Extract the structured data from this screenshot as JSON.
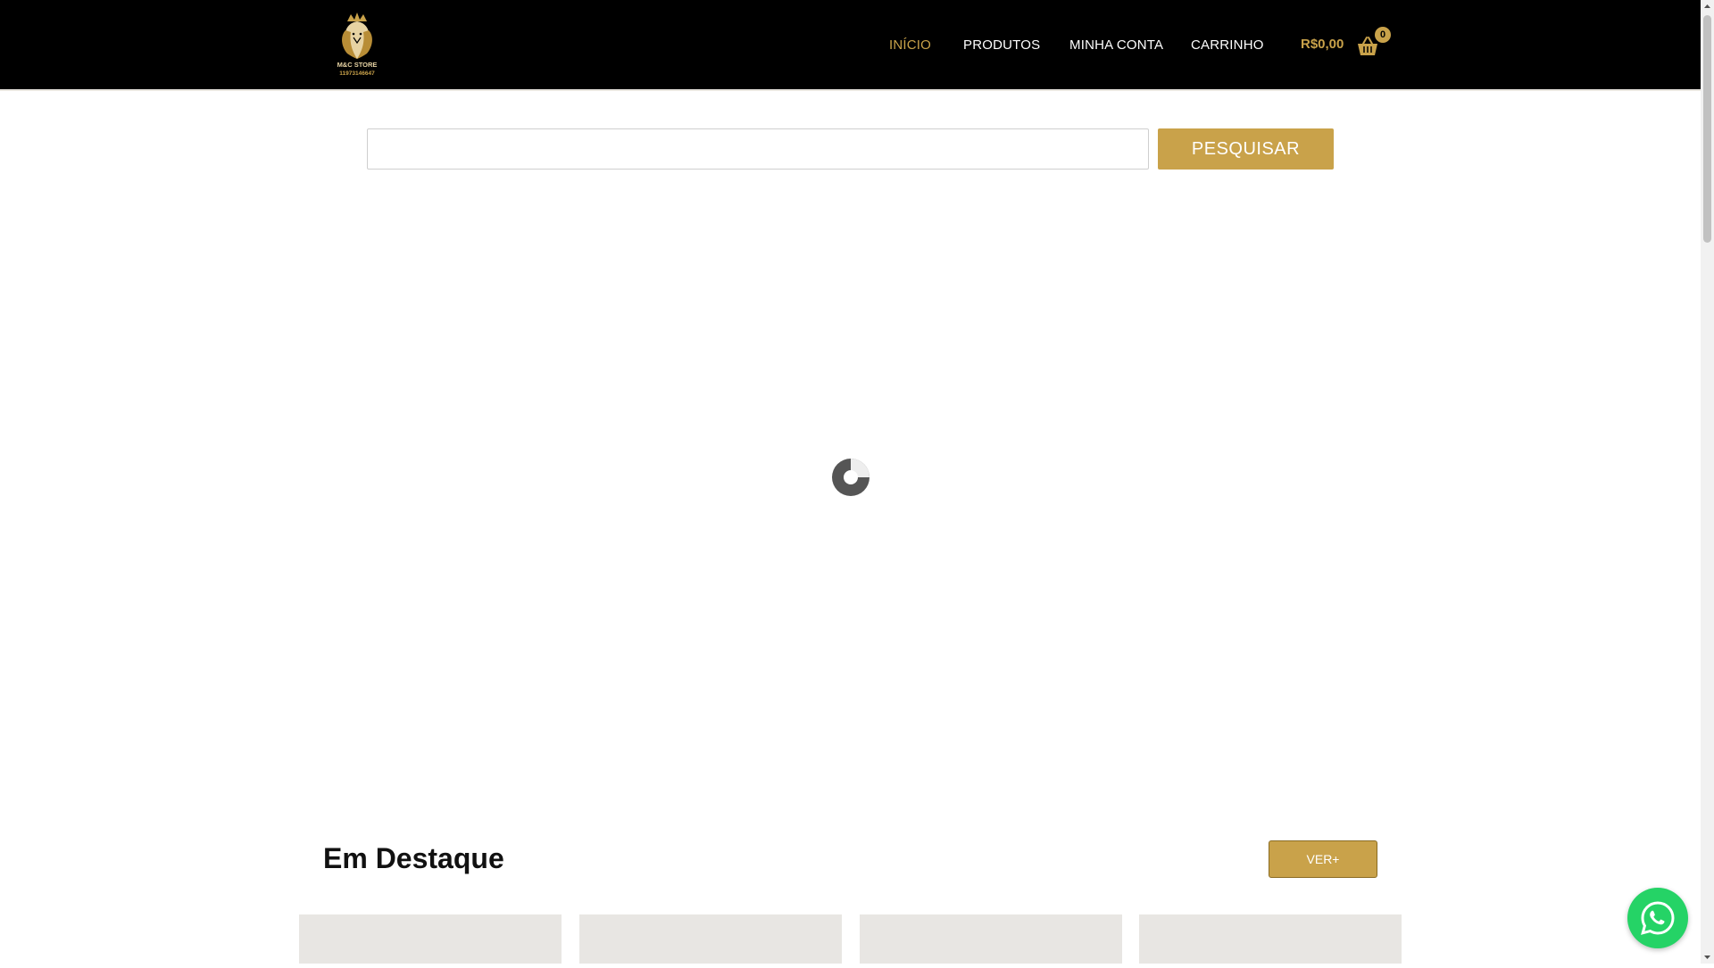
{
  "header": {
    "logo": {
      "brand_text": "M&C STORE",
      "phone_text": "11973146647"
    },
    "nav": [
      {
        "label": "INÍCIO",
        "active": true
      },
      {
        "label": "PRODUTOS",
        "active": false
      },
      {
        "label": "MINHA CONTA",
        "active": false
      },
      {
        "label": "CARRINHO",
        "active": false
      }
    ],
    "cart": {
      "total": "R$0,00",
      "count": "0",
      "icon": "shopping-basket-icon"
    }
  },
  "search": {
    "value": "",
    "placeholder": "",
    "button_label": "PESQUISAR"
  },
  "loader": {
    "icon": "loading-spinner-icon"
  },
  "featured": {
    "title": "Em Destaque",
    "see_more_label": "VER+",
    "cards": 4
  },
  "whatsapp": {
    "icon": "whatsapp-icon"
  },
  "colors": {
    "accent": "#c9a24a",
    "header_bg": "#000000",
    "whatsapp": "#25d366",
    "card_placeholder": "#e8e6e3"
  }
}
